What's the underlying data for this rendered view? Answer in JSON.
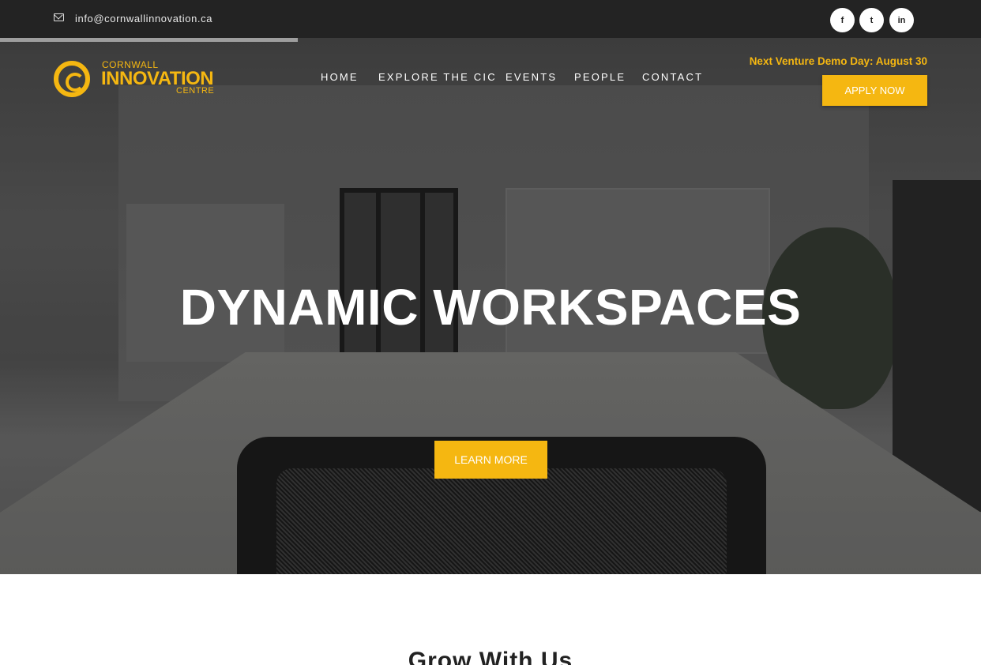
{
  "topbar": {
    "email": "info@cornwallinnovation.ca",
    "social": [
      {
        "icon": "facebook-icon",
        "glyph": "f"
      },
      {
        "icon": "twitter-icon",
        "glyph": "t"
      },
      {
        "icon": "linkedin-icon",
        "glyph": "in"
      }
    ]
  },
  "logo": {
    "line1": "CORNWALL",
    "line2": "INNOVATION",
    "line3": "CENTRE"
  },
  "nav": {
    "items": [
      "HOME",
      "EXPLORE THE CIC",
      "EVENTS",
      "PEOPLE",
      "CONTACT"
    ]
  },
  "header": {
    "demo_day": "Next Venture Demo Day: August 30",
    "apply_label": "APPLY NOW"
  },
  "hero": {
    "title": "DYNAMIC WORKSPACES",
    "cta_label": "LEARN MORE"
  },
  "section": {
    "title": "Grow With Us"
  },
  "colors": {
    "accent": "#f5b711",
    "topbar": "#232323"
  }
}
